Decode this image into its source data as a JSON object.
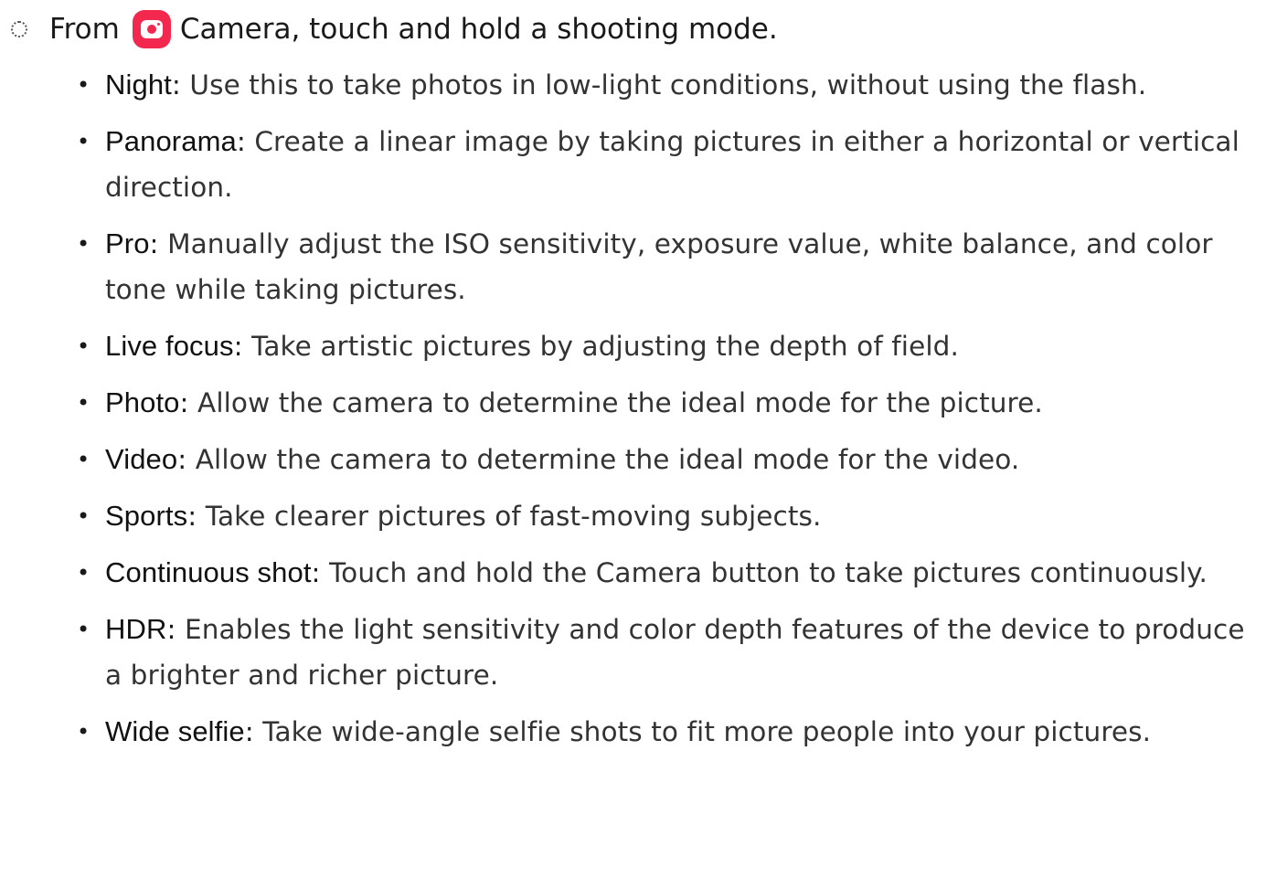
{
  "step": {
    "prefix": "From",
    "app_name": "Camera",
    "suffix": ", touch and hold a shooting mode."
  },
  "modes": [
    {
      "term": "Night",
      "description": "Use this to take photos in low-light conditions, without using the flash."
    },
    {
      "term": "Panorama",
      "description": "Create a linear image by taking pictures in either a horizontal or vertical direction."
    },
    {
      "term": "Pro",
      "description": "Manually adjust the ISO sensitivity, exposure value, white balance, and color tone while taking pictures."
    },
    {
      "term": "Live focus",
      "description": "Take artistic pictures by adjusting the depth of field."
    },
    {
      "term": "Photo",
      "description": "Allow the camera to determine the ideal mode for the picture."
    },
    {
      "term": "Video",
      "description": "Allow the camera to determine the ideal mode for the video."
    },
    {
      "term": "Sports",
      "description": "Take clearer pictures of fast-moving subjects."
    },
    {
      "term": "Continuous shot",
      "description": "Touch and hold the Camera button to take pictures continuously."
    },
    {
      "term": "HDR",
      "description": "Enables the light sensitivity and color depth features of the device to produce a brighter and richer picture."
    },
    {
      "term": "Wide selfie",
      "description": "Take wide-angle selfie shots to fit more people into your pictures."
    }
  ],
  "colors": {
    "camera_icon": "#f2284f"
  },
  "icons": {
    "step": "dotted-circle-icon",
    "app": "camera-app-icon"
  }
}
